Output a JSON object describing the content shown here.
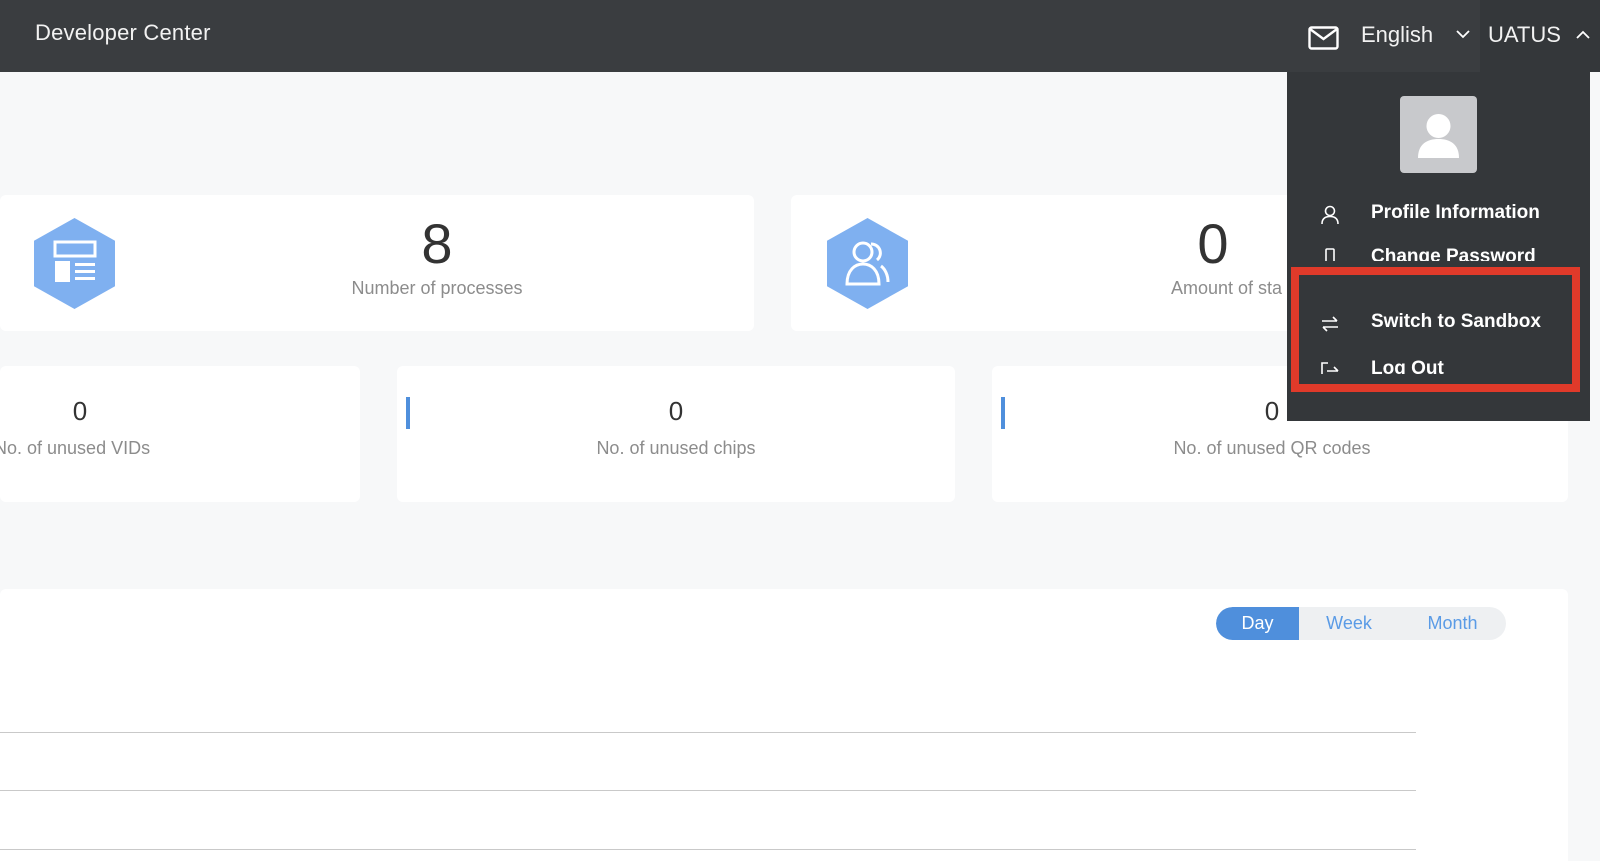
{
  "header": {
    "brand": "Developer Center",
    "language": "English",
    "username": "UATUS"
  },
  "stats_top": [
    {
      "value": "8",
      "label": "Number of processes"
    },
    {
      "value": "0",
      "label": "Amount of sta"
    }
  ],
  "stats_bottom": [
    {
      "value": "0",
      "label": "No. of unused VIDs"
    },
    {
      "value": "0",
      "label": "No. of unused chips"
    },
    {
      "value": "0",
      "label": "No. of unused QR codes"
    }
  ],
  "period_toggle": {
    "options": [
      "Day",
      "Week",
      "Month"
    ],
    "selected": "Day"
  },
  "user_menu": {
    "items": [
      {
        "label": "Profile Information",
        "icon": "user-icon"
      },
      {
        "label": "Change Password",
        "icon": "key-icon"
      },
      {
        "label": "Switch to Sandbox",
        "icon": "switch-icon"
      },
      {
        "label": "Log Out",
        "icon": "logout-icon"
      }
    ]
  },
  "colors": {
    "header_bg": "#3a3d40",
    "accent": "#4f8fdc",
    "icon_blue": "#7fb0f0",
    "highlight": "#e03a2a"
  }
}
